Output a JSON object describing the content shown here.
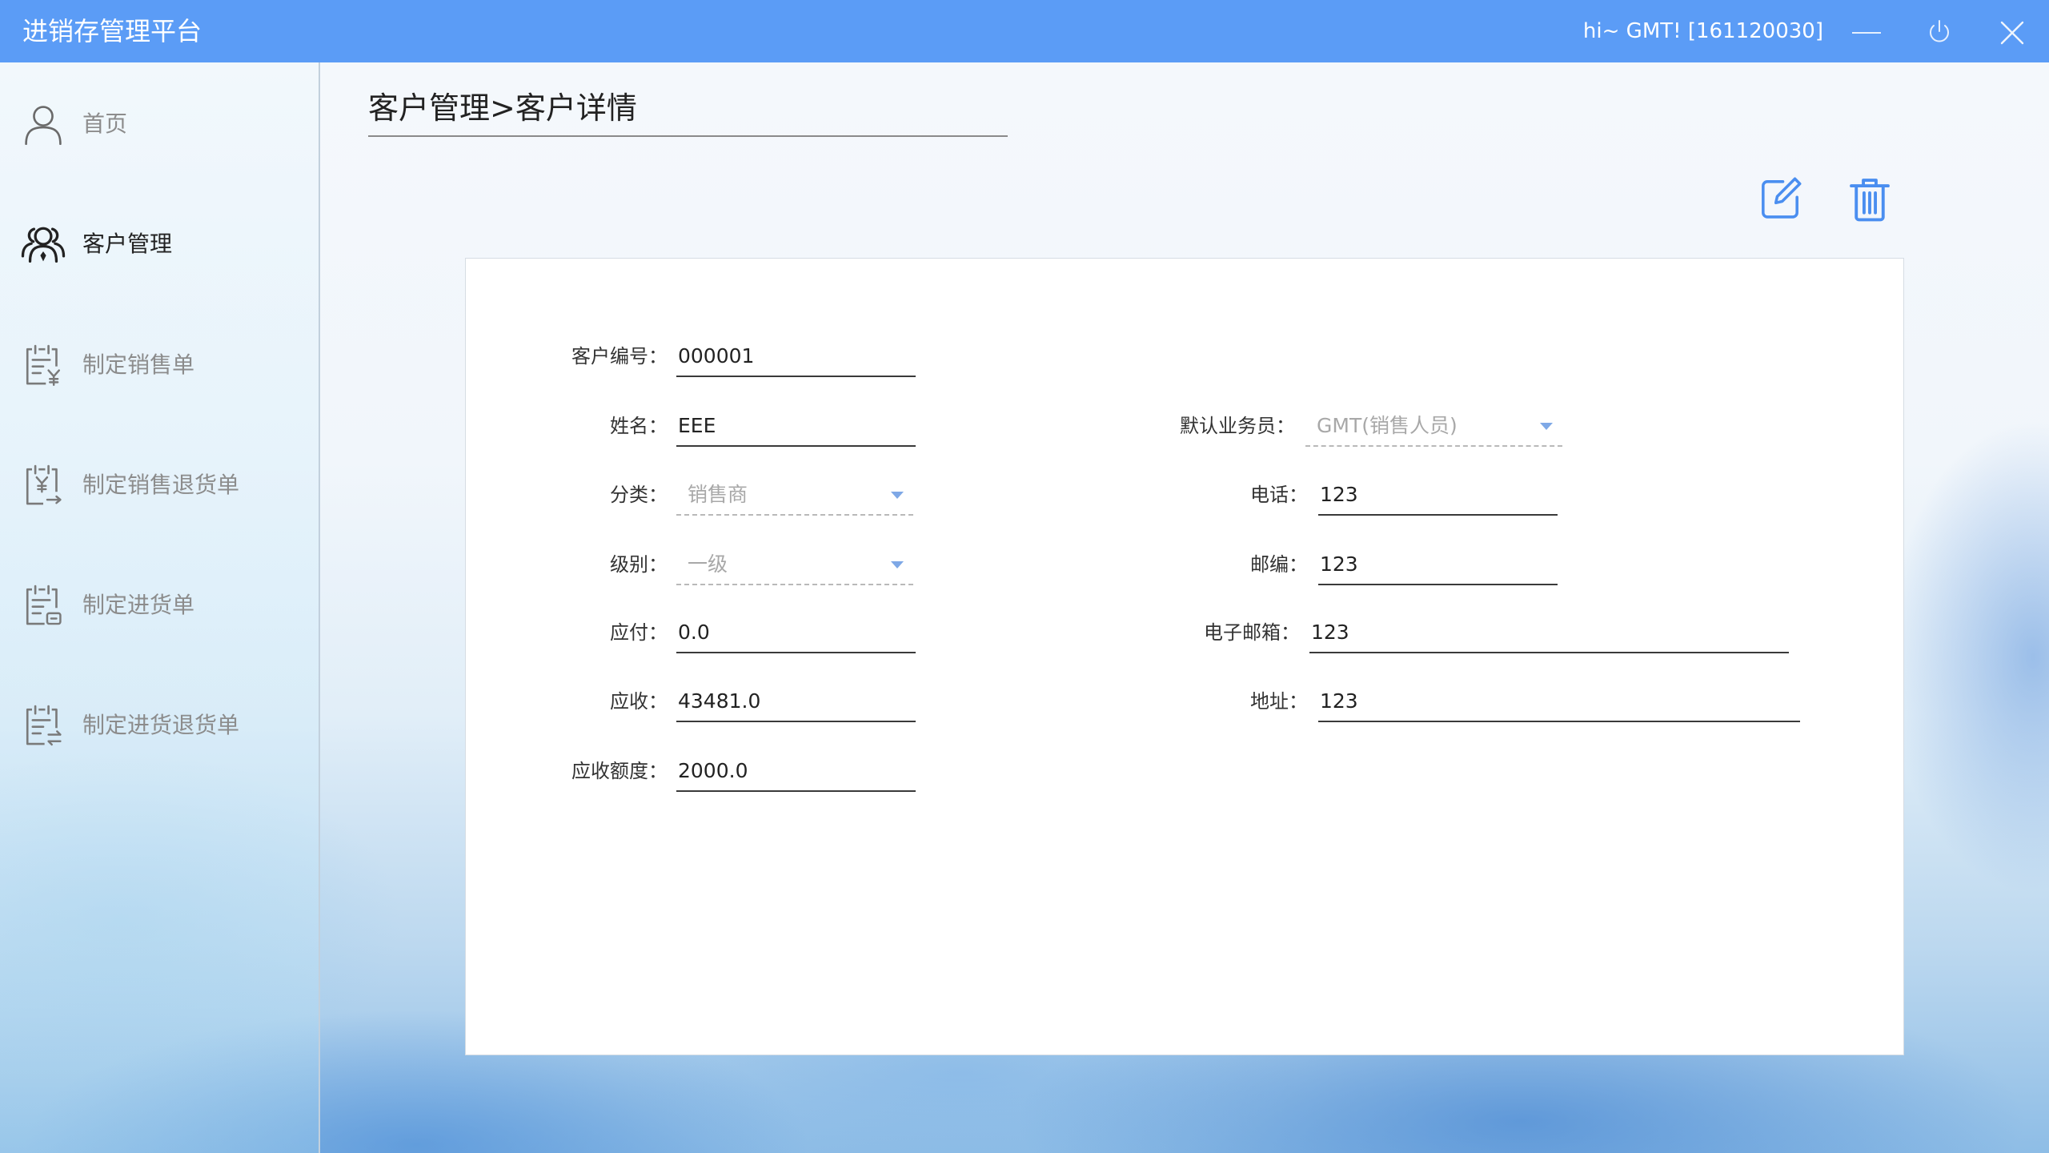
{
  "app": {
    "title": "进销存管理平台",
    "greeting": "hi~ GMT! [161120030]"
  },
  "window_controls": {
    "minimize_icon": "minimize-icon",
    "power_icon": "power-icon",
    "close_icon": "close-icon"
  },
  "sidebar": {
    "items": [
      {
        "label": "首页",
        "icon": "user-icon",
        "active": false
      },
      {
        "label": "客户管理",
        "icon": "users-icon",
        "active": true
      },
      {
        "label": "制定销售单",
        "icon": "sales-order-icon",
        "active": false
      },
      {
        "label": "制定销售退货单",
        "icon": "sales-return-icon",
        "active": false
      },
      {
        "label": "制定进货单",
        "icon": "purchase-order-icon",
        "active": false
      },
      {
        "label": "制定进货退货单",
        "icon": "purchase-return-icon",
        "active": false
      }
    ]
  },
  "breadcrumb": {
    "text": "客户管理>客户详情"
  },
  "toolbar": {
    "edit_icon": "edit-icon",
    "delete_icon": "trash-icon"
  },
  "form": {
    "customer_id": {
      "label": "客户编号：",
      "value": "000001"
    },
    "name": {
      "label": "姓名：",
      "value": "EEE"
    },
    "category": {
      "label": "分类：",
      "value": "销售商"
    },
    "level": {
      "label": "级别：",
      "value": "一级"
    },
    "payable": {
      "label": "应付：",
      "value": "0.0"
    },
    "receivable": {
      "label": "应收：",
      "value": "43481.0"
    },
    "credit_limit": {
      "label": "应收额度：",
      "value": "2000.0"
    },
    "salesperson": {
      "label": "默认业务员：",
      "value": "GMT(销售人员)"
    },
    "phone": {
      "label": "电话：",
      "value": "123"
    },
    "postcode": {
      "label": "邮编：",
      "value": "123"
    },
    "email": {
      "label": "电子邮箱：",
      "value": "123"
    },
    "address": {
      "label": "地址：",
      "value": "123"
    }
  },
  "colors": {
    "title_bar": "#5b9cf6",
    "accent": "#4a8ef0",
    "active_text": "#222222",
    "inactive_text": "#8c8c8c"
  }
}
